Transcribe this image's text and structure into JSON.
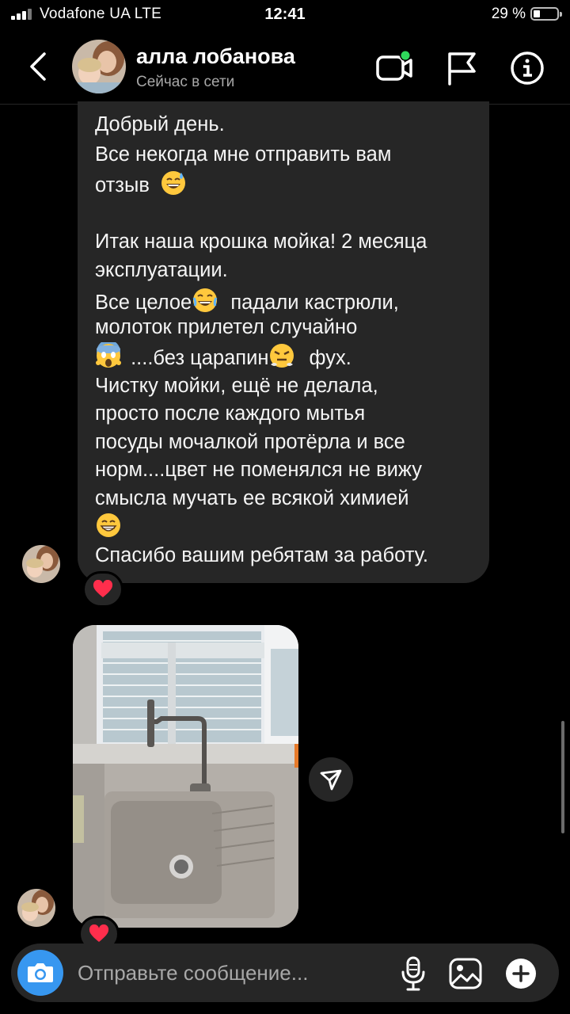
{
  "status_bar": {
    "carrier": "Vodafone UA  LTE",
    "time": "12:41",
    "battery": "29 %",
    "battery_level": 0.29
  },
  "header": {
    "name": "алла лобанова",
    "status": "Сейчас в сети",
    "icons": [
      "chevron-left-icon",
      "video-call-icon",
      "flag-icon",
      "info-icon"
    ],
    "online_dot_color": "#2fd85b"
  },
  "message": {
    "lines": [
      "Добрый день.",
      "Все некогда мне отправить вам",
      "отзыв",
      "",
      "Итак наша крошка мойка! 2 месяца",
      "эксплуатации.",
      "Все целое",
      "падали кастрюли,",
      "молоток прилетел случайно",
      "....без царапин",
      "фух.",
      "Чистку мойки, ещё не делала,",
      "просто после каждого мытья",
      "посуды мочалкой протёрла и все",
      "норм....цвет не поменялся не вижу",
      "смысла мучать ее всякой химией",
      "Спасибо вашим ребятам за работу."
    ],
    "emojis": [
      "grinning-sweat-emoji",
      "rolling-laughing-emoji",
      "screaming-fear-emoji",
      "steam-nose-emoji",
      "beaming-grin-emoji"
    ],
    "reaction": "❤️"
  },
  "photo_message": {
    "reaction": "❤️",
    "share_icon": "send-icon"
  },
  "composer": {
    "placeholder": "Отправьте сообщение...",
    "icons": [
      "camera-icon",
      "microphone-icon",
      "gallery-icon",
      "plus-icon"
    ],
    "accent": "#3797f0"
  }
}
